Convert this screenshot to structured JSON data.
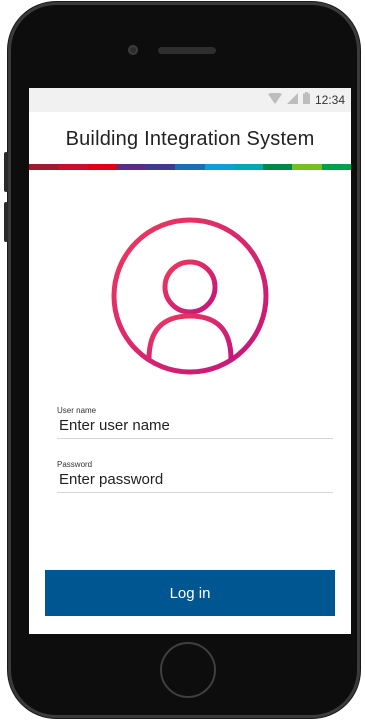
{
  "status_bar": {
    "time": "12:34",
    "icons": [
      "wifi-icon",
      "cell-signal-icon",
      "battery-icon"
    ]
  },
  "app": {
    "title": "Building Integration System",
    "band_colors": [
      "#9e1b32",
      "#c8102e",
      "#e20015",
      "#5b2c83",
      "#3e3a8f",
      "#1a6fb7",
      "#0e9fd8",
      "#00a8b0",
      "#00884a",
      "#78be20",
      "#00a14b"
    ]
  },
  "login": {
    "avatar_icon": "user-profile-icon",
    "username_label": "User name",
    "username_placeholder": "Enter user name",
    "password_label": "Password",
    "password_placeholder": "Enter password",
    "button_label": "Log in",
    "button_color": "#005691"
  }
}
